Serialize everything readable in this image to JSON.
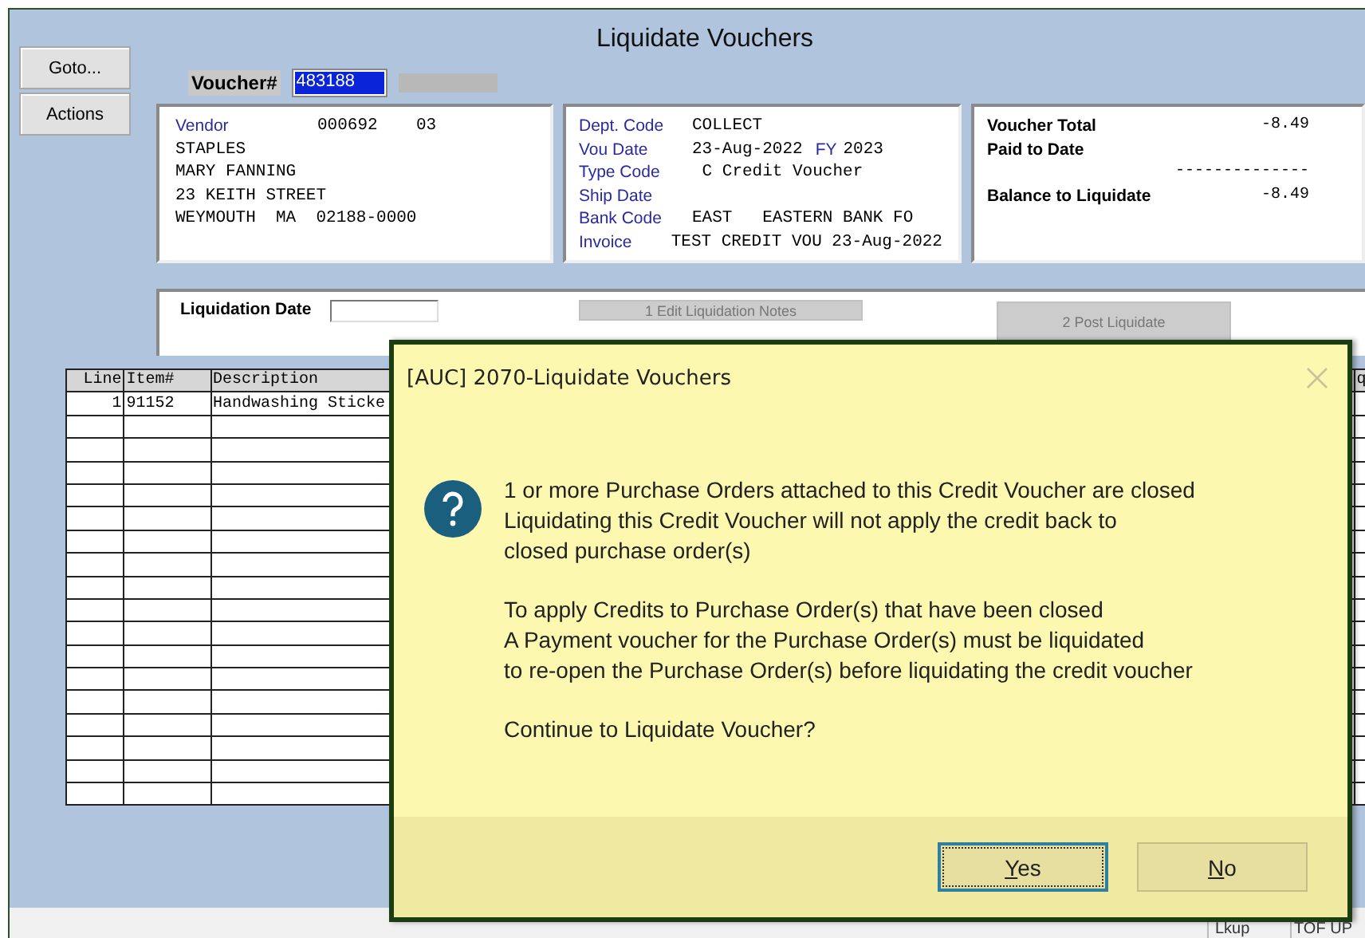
{
  "window": {
    "title": "Liquidate Vouchers"
  },
  "side_buttons": [
    "Goto...",
    "Actions"
  ],
  "voucher": {
    "label": "Voucher#",
    "value": "483188"
  },
  "vendor_panel": {
    "label": "Vendor",
    "number": "000692",
    "suffix": "03",
    "lines": [
      "STAPLES",
      "MARY FANNING",
      "23 KEITH STREET",
      "WEYMOUTH  MA  02188-0000"
    ]
  },
  "details": [
    {
      "label": "Dept. Code",
      "value": "COLLECT"
    },
    {
      "label": "Vou Date",
      "value": "23-Aug-2022",
      "fy_label": "FY",
      "fy": "2023"
    },
    {
      "label": "Type Code",
      "value": " C Credit Voucher"
    },
    {
      "label": "Ship Date"
    },
    {
      "label": "Bank Code",
      "value": "EAST   EASTERN BANK FO"
    },
    {
      "label": "Invoice",
      "value": "TEST CREDIT VOU 23-Aug-2022"
    }
  ],
  "totals": {
    "voucher_total_label": "Voucher Total",
    "voucher_total": "-8.49",
    "paid_to_date_label": "Paid to Date",
    "separator": "--------------",
    "balance_label": "Balance to Liquidate",
    "balance": "-8.49"
  },
  "liquidation": {
    "date_label": "Liquidation Date",
    "buttons": [
      {
        "label": "1 Edit Liquidation Notes",
        "disabled": true
      },
      {
        "label": "2 Post Liquidate",
        "disabled": true
      }
    ]
  },
  "table": {
    "columns": [
      "Line",
      "Item#",
      "Description",
      "q"
    ],
    "rows": [
      [
        "1",
        "91152",
        "Handwashing Sticke"
      ]
    ]
  },
  "dialog": {
    "title": "[AUC] 2070-Liquidate Vouchers",
    "paragraphs": [
      [
        "1 or more Purchase Orders attached to this Credit Voucher are closed",
        "Liquidating this Credit Voucher will not apply the credit back to",
        "closed purchase order(s)"
      ],
      [
        "To apply Credits to Purchase Order(s) that have been closed",
        "A Payment voucher for the Purchase Order(s) must be liquidated",
        "to re-open the Purchase Order(s) before liquidating the credit voucher"
      ],
      [
        "Continue to Liquidate Voucher?"
      ]
    ],
    "buttons": [
      {
        "label": "Yes",
        "focused": true
      },
      {
        "label": "No",
        "focused": false
      }
    ]
  },
  "status_bar": [
    "Lkup",
    "TOF UP"
  ]
}
